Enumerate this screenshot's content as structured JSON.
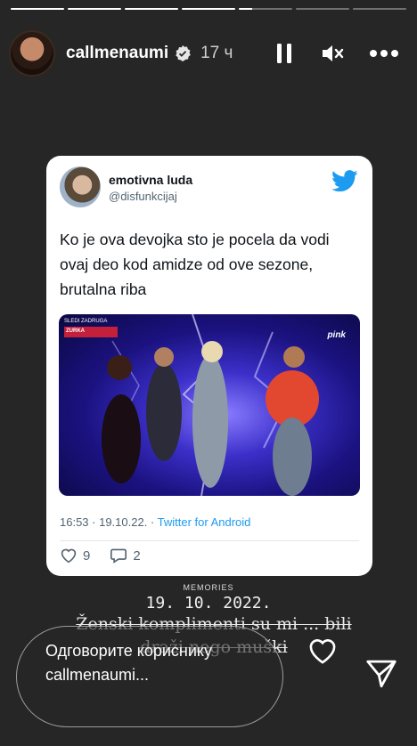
{
  "story": {
    "progress": [
      1,
      1,
      1,
      1,
      0.25,
      0,
      0
    ],
    "username": "callmenaumi",
    "time_ago": "17 ч",
    "verified": true
  },
  "tweet": {
    "name": "emotivna luda",
    "handle": "@disfunkcijaj",
    "text": "Ko je ova devojka sto je pocela da vodi ovaj deo kod amidze od ove sezone, brutalna riba",
    "timestamp": "16:53 · 19.10.22. · ",
    "source": "Twitter for Android",
    "likes": "9",
    "replies": "2",
    "photo_overlay_1": "SLEDI ZADRUGA",
    "photo_overlay_2": "ZURKA",
    "photo_logo": "pink"
  },
  "memories": {
    "label": "MEMORIES",
    "date": "19. 10. 2022."
  },
  "caption": "Ženski komplimenti su mi ... bili draži nego muški",
  "reply": {
    "placeholder": "Одговорите кориснику callmenaumi..."
  },
  "icons": {
    "verified": "verified-badge-icon",
    "pause": "pause-icon",
    "mute": "speaker-muted-icon",
    "more": "more-dots-icon",
    "bird": "twitter-bird-icon",
    "heart": "heart-icon",
    "send": "send-icon"
  },
  "colors": {
    "background": "#262626",
    "twitter_blue": "#1d9bf0"
  }
}
